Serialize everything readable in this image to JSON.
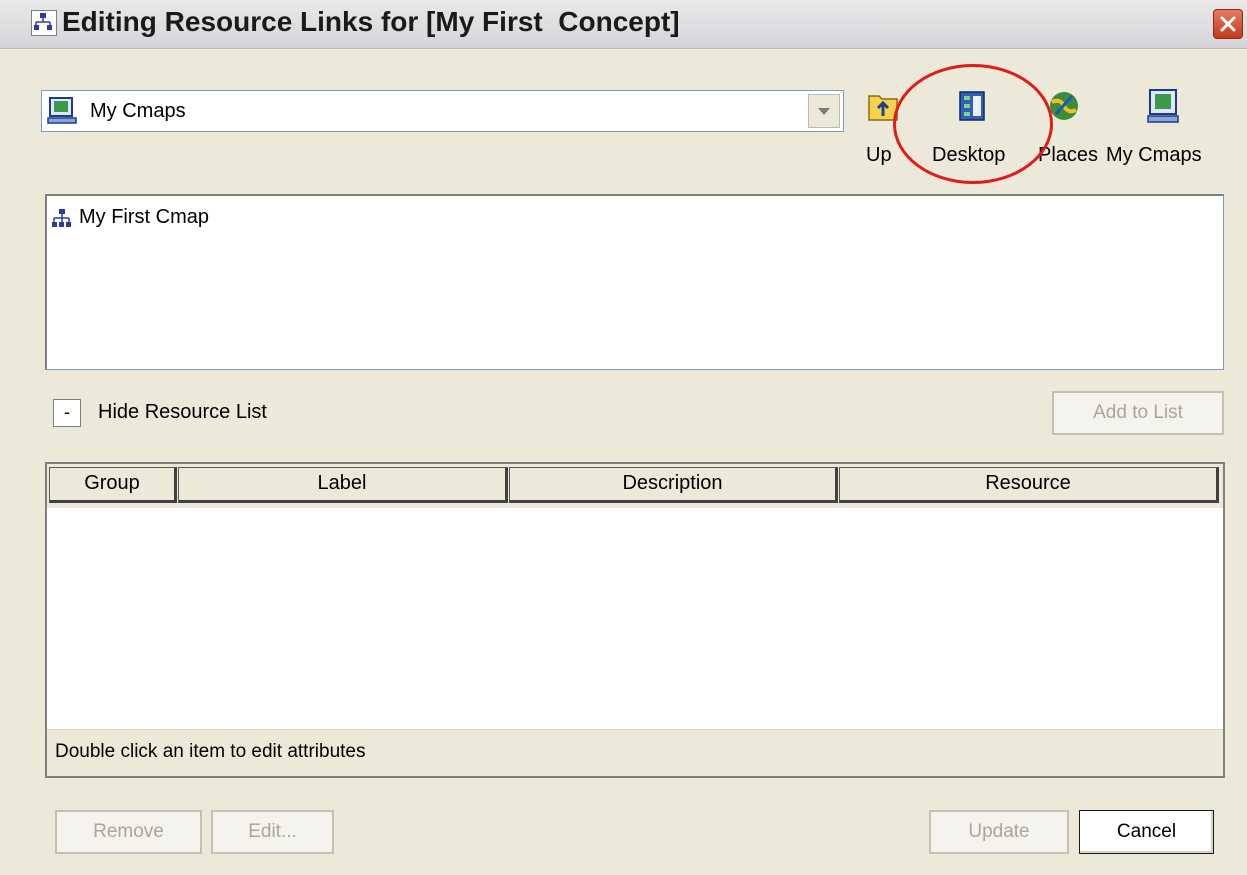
{
  "window": {
    "title": "Editing Resource Links for [My First  Concept]",
    "title_icon": "cmap-network-icon",
    "close_icon": "close-icon"
  },
  "location": {
    "selected": "My Cmaps",
    "icon": "my-cmaps-computer-icon"
  },
  "toolbar": {
    "up_label": "Up",
    "desktop_label": "Desktop",
    "places_label": "Places",
    "mycmaps_label": "My Cmaps"
  },
  "files": [
    {
      "label": "My First Cmap",
      "icon": "cmap-file-icon"
    }
  ],
  "resource_list": {
    "toggle_label": "-",
    "hide_label": "Hide Resource List",
    "add_to_list_label": "Add to List"
  },
  "table": {
    "columns": [
      "Group",
      "Label",
      "Description",
      "Resource"
    ],
    "rows": [],
    "status": "Double click an item to edit attributes"
  },
  "buttons": {
    "remove": "Remove",
    "edit": "Edit...",
    "update": "Update",
    "cancel": "Cancel"
  },
  "colors": {
    "highlight": "#e11a1a",
    "window_bg": "#ece9d8",
    "close_button": "#c23a1c"
  }
}
